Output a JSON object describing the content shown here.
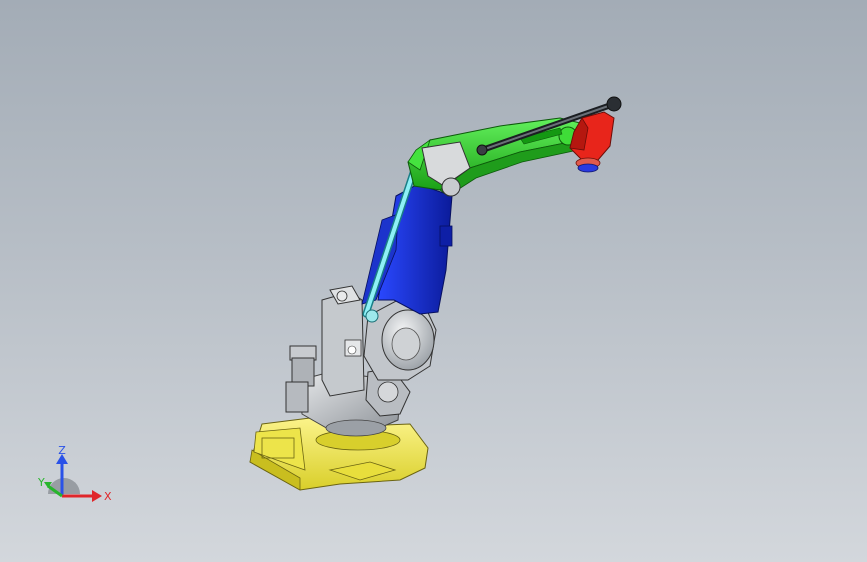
{
  "colors": {
    "base_yellow": "#f2ea4a",
    "base_yellow_dark": "#b8ad1e",
    "gray_body": "#bfc3c8",
    "gray_dark": "#6f747a",
    "upper_arm_blue": "#1530d8",
    "upper_arm_blue_dark": "#0a1a8a",
    "forearm_green": "#2fd32a",
    "forearm_green_dark": "#138a12",
    "wrist_red": "#e8251b",
    "rod_cyan": "#7fe6ee",
    "flange_blue": "#2a3ae0",
    "axis_x": "#e0262a",
    "axis_y": "#27b52c",
    "axis_z": "#2a52e8"
  },
  "triad": {
    "x_label": "X",
    "y_label": "Y",
    "z_label": "Z"
  },
  "parts": {
    "base": "base",
    "turret": "turret",
    "upper_arm": "upper-arm",
    "forearm": "forearm",
    "wrist": "wrist",
    "parallel_rod": "parallel-link-rod",
    "motor_housing": "motor-housing"
  }
}
